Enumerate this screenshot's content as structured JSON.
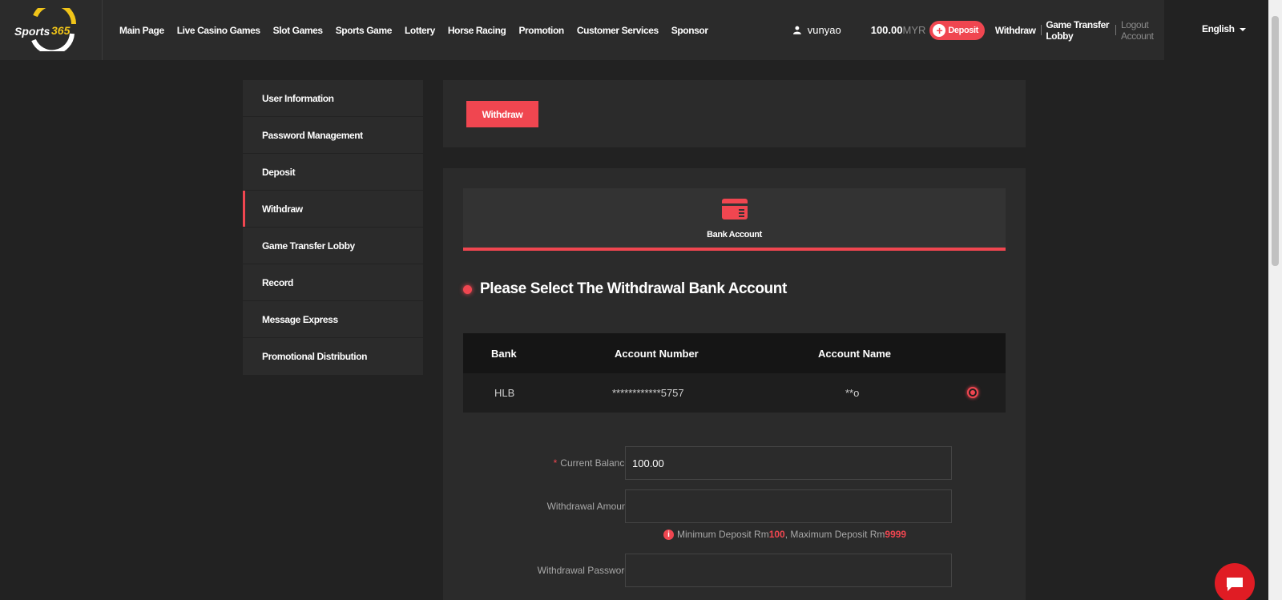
{
  "brand": {
    "logo_text": "Sports365",
    "accent": "#f04650"
  },
  "nav": [
    "Main Page",
    "Live Casino Games",
    "Slot Games",
    "Sports Game",
    "Lottery",
    "Horse Racing",
    "Promotion",
    "Customer Services",
    "Sponsor"
  ],
  "user": {
    "name": "vunyao",
    "balance": "100.00",
    "currency": "MYR",
    "deposit_label": "Deposit",
    "withdraw_label": "Withdraw",
    "transfer_label": "Game Transfer Lobby",
    "logout_label": "Logout Account"
  },
  "language": "English",
  "sidebar": [
    {
      "label": "User Information",
      "active": false
    },
    {
      "label": "Password Management",
      "active": false
    },
    {
      "label": "Deposit",
      "active": false
    },
    {
      "label": "Withdraw",
      "active": true
    },
    {
      "label": "Game Transfer Lobby",
      "active": false
    },
    {
      "label": "Record",
      "active": false
    },
    {
      "label": "Message Express",
      "active": false
    },
    {
      "label": "Promotional Distribution",
      "active": false
    }
  ],
  "tab": {
    "label": "Withdraw"
  },
  "method": {
    "label": "Bank Account",
    "icon": "bank-card-icon"
  },
  "section_title": "Please Select The Withdrawal Bank Account",
  "bank_table": {
    "headers": [
      "Bank",
      "Account Number",
      "Account Name"
    ],
    "rows": [
      {
        "bank": "HLB",
        "account_number": "************5757",
        "account_name": "**o",
        "selected": true
      }
    ]
  },
  "form": {
    "current_balance_label": "Current Balance",
    "current_balance_value": "100.00",
    "amount_label": "Withdrawal Amount",
    "amount_value": "",
    "hint_prefix": "Minimum Deposit Rm",
    "hint_min": "100",
    "hint_mid": ", Maximum Deposit Rm",
    "hint_max": "9999",
    "password_label": "Withdrawal Password",
    "password_value": ""
  }
}
